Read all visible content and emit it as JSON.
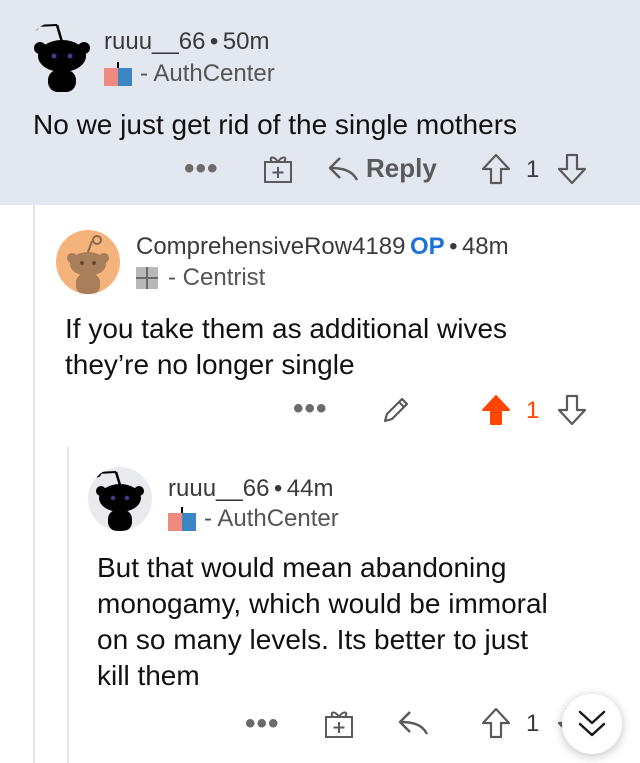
{
  "comments": [
    {
      "username": "ruuu__66",
      "separator": "•",
      "time": "50m",
      "flair_text": "- AuthCenter",
      "body": "No we just get rid of the single mothers",
      "actions": {
        "more": "•••",
        "reply": "Reply",
        "votes": "1"
      }
    },
    {
      "username": "ComprehensiveRow4189",
      "op_badge": "OP",
      "separator": "•",
      "time": "48m",
      "flair_text": "- Centrist",
      "body_lines": [
        "If you take them as additional wives",
        "they’re no longer single"
      ],
      "actions": {
        "more": "•••",
        "votes": "1",
        "upvoted": true
      }
    },
    {
      "username": "ruuu__66",
      "separator": "•",
      "time": "44m",
      "flair_text": "- AuthCenter",
      "body_lines": [
        "But that would mean abandoning",
        "monogamy, which would be immoral",
        "on so many levels. Its better to just",
        "kill them"
      ],
      "actions": {
        "more": "•••",
        "votes": "1"
      }
    }
  ],
  "colors": {
    "highlight_bg": "#e3e7ef",
    "upvote_orange": "#ff4500",
    "op_blue": "#1f72d8",
    "authcenter_red": "#f08a80",
    "authcenter_blue": "#3d86c6"
  },
  "icons": [
    "snoo-avatar-icon",
    "award-icon",
    "reply-arrow-icon",
    "upvote-icon",
    "downvote-icon",
    "edit-pencil-icon",
    "collapse-chevron-icon"
  ]
}
